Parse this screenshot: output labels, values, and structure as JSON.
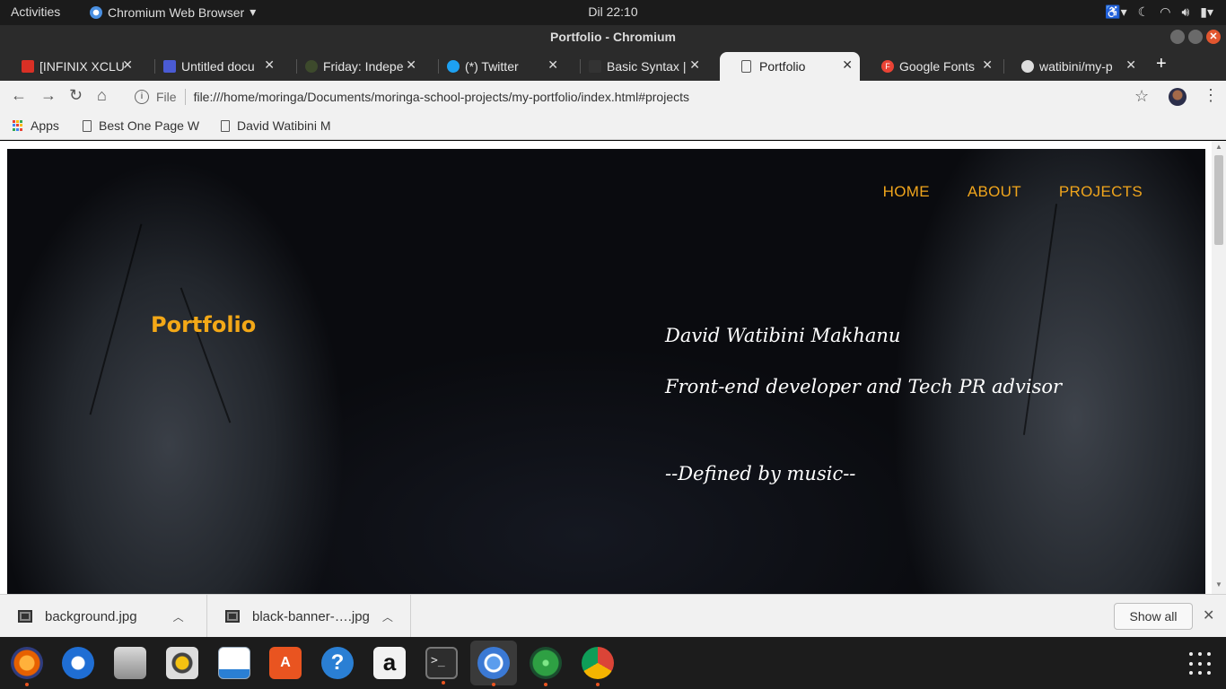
{
  "topbar": {
    "activities": "Activities",
    "app_menu": "Chromium Web Browser",
    "clock": "Dil 22:10"
  },
  "window": {
    "title": "Portfolio - Chromium"
  },
  "tabs": [
    {
      "title": "[INFINIX XCLU",
      "icon": "gmail-icon",
      "active": false
    },
    {
      "title": "Untitled docu",
      "icon": "docs-icon",
      "active": false
    },
    {
      "title": "Friday: Indepe",
      "icon": "leaf-icon",
      "active": false
    },
    {
      "title": "(*) Twitter",
      "icon": "twitter-icon",
      "active": false
    },
    {
      "title": "Basic Syntax |",
      "icon": "markdown-icon",
      "active": false
    },
    {
      "title": "Portfolio",
      "icon": "page-icon",
      "active": true
    },
    {
      "title": "Google Fonts",
      "icon": "google-fonts-icon",
      "active": false
    },
    {
      "title": "watibini/my-p",
      "icon": "github-icon",
      "active": false
    }
  ],
  "toolbar": {
    "scheme_label": "File",
    "url": "file:///home/moringa/Documents/moringa-school-projects/my-portfolio/index.html#projects"
  },
  "bookmarks": {
    "apps": "Apps",
    "items": [
      "Best One Page W",
      "David Watibini M"
    ]
  },
  "page": {
    "nav": [
      "HOME",
      "ABOUT",
      "PROJECTS"
    ],
    "brand": "Portfolio",
    "name": "David Watibini Makhanu",
    "role": "Front-end developer and Tech PR advisor",
    "motto": "--Defined by music--",
    "colors": {
      "accent": "#f0a51c",
      "text": "#ffffff",
      "background": "#050506"
    }
  },
  "downloads": {
    "items": [
      "background.jpg",
      "black-banner-….jpg"
    ],
    "show_all": "Show all"
  },
  "dock": {
    "apps": [
      "firefox-icon",
      "thunderbird-icon",
      "files-icon",
      "rhythmbox-icon",
      "writer-icon",
      "software-icon",
      "help-icon",
      "amazon-icon",
      "terminal-icon",
      "chromium-icon",
      "atom-icon",
      "chrome-icon"
    ]
  }
}
